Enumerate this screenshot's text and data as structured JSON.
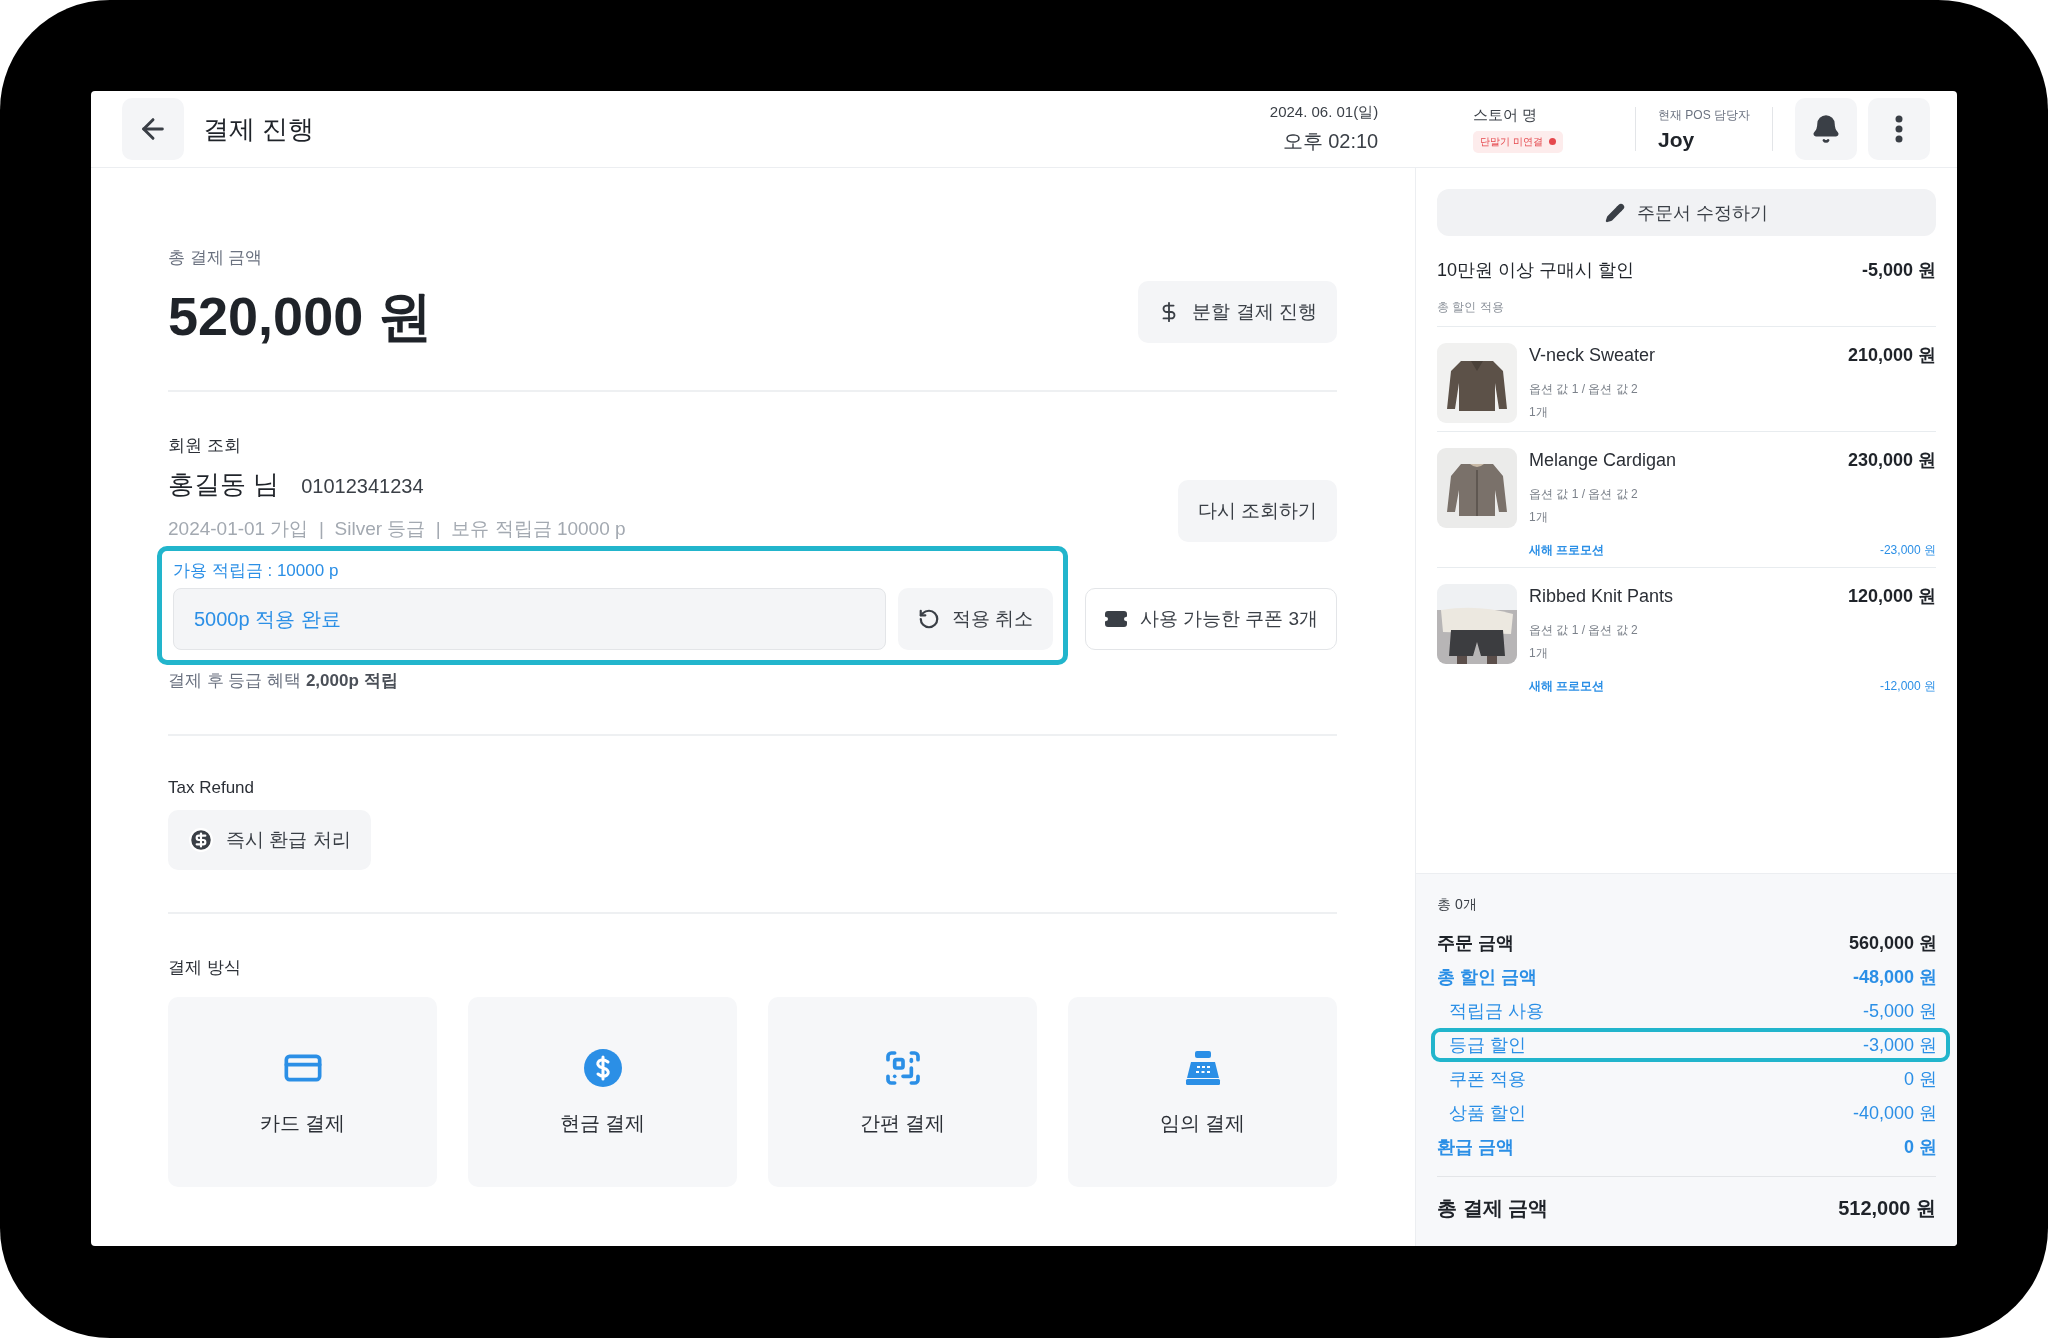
{
  "header": {
    "title": "결제 진행",
    "date": "2024. 06. 01(일)",
    "time": "오후 02:10",
    "store_label": "스토어 명",
    "device_status": {
      "label": "단말기 미연결",
      "connected": false
    },
    "staff_label": "현재 POS 담당자",
    "staff_name": "Joy"
  },
  "payment": {
    "label": "총 결제 금액",
    "amount": "520,000 원",
    "split_button": "분할 결제 진행"
  },
  "member": {
    "label": "회원 조회",
    "name": "홍길동 님",
    "phone": "01012341234",
    "meta": "2024-01-01 가입  |  Silver 등급  |  보유 적립금 10000 p",
    "recheck_button": "다시 조회하기",
    "points": {
      "highlighted": true,
      "available": "가용 적립금 : 10000 p",
      "value": "5000p 적용 완료",
      "cancel_button": "적용 취소"
    },
    "coupon_button": "사용 가능한 쿠폰 3개",
    "benefit": "결제 후 등급 혜택 **2,000p 적립**"
  },
  "tax_refund": {
    "label": "Tax Refund",
    "button": "즉시 환급 처리"
  },
  "methods": {
    "label": "결제 방식",
    "items": [
      {
        "kind": "card",
        "label": "카드 결제"
      },
      {
        "kind": "cash",
        "label": "현금 결제"
      },
      {
        "kind": "qr",
        "label": "간편 결제"
      },
      {
        "kind": "register",
        "label": "임의 결제"
      }
    ]
  },
  "order": {
    "edit_button": "주문서 수정하기",
    "discount": {
      "label": "10만원 이상 구매시 할인",
      "amount": "-5,000 원",
      "note": "총 할인 적용"
    },
    "items": [
      {
        "kind": "sweater",
        "name": "V-neck Sweater",
        "price": "210,000 원",
        "options": "옵션 값 1 / 옵션 값 2",
        "quantity": "1개"
      },
      {
        "kind": "cardigan",
        "name": "Melange Cardigan",
        "price": "230,000 원",
        "options": "옵션 값 1 / 옵션 값 2",
        "quantity": "1개",
        "promotion": {
          "label": "새해 프로모션",
          "amount": "-23,000 원"
        }
      },
      {
        "kind": "pants",
        "name": "Ribbed Knit Pants",
        "price": "120,000 원",
        "options": "옵션 값 1 / 옵션 값 2",
        "quantity": "1개",
        "promotion": {
          "label": "새해 프로모션",
          "amount": "-12,000 원"
        }
      }
    ]
  },
  "summary": {
    "count": "총 0개",
    "rows": [
      {
        "kind": "total",
        "label": "주문 금액",
        "amount": "560,000 원",
        "highlighted": false
      },
      {
        "kind": "group",
        "label": "총 할인 금액",
        "amount": "-48,000 원",
        "highlighted": false
      },
      {
        "kind": "sub",
        "label": "적립금 사용",
        "amount": "-5,000 원",
        "highlighted": false
      },
      {
        "kind": "sub",
        "label": "등급 할인",
        "amount": "-3,000 원",
        "highlighted": true
      },
      {
        "kind": "sub",
        "label": "쿠폰 적용",
        "amount": "0 원",
        "highlighted": false
      },
      {
        "kind": "sub",
        "label": "상품 할인",
        "amount": "-40,000 원",
        "highlighted": false
      },
      {
        "kind": "group",
        "label": "환급 금액",
        "amount": "0 원",
        "highlighted": false
      }
    ],
    "total": {
      "label": "총 결제 금액",
      "amount": "512,000 원"
    }
  }
}
